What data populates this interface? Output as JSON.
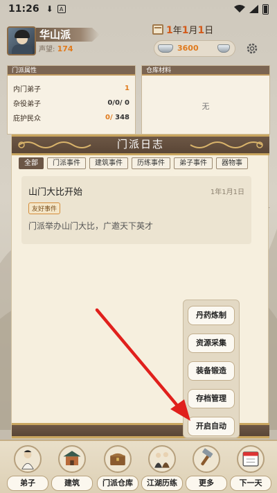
{
  "status_bar": {
    "time": "11:26"
  },
  "header": {
    "sect_name": "华山派",
    "prestige_label": "声望:",
    "prestige_value": "174",
    "date_year": "1",
    "date_year_unit": "年",
    "date_month": "1",
    "date_month_unit": "月",
    "date_day": "1",
    "date_day_unit": "日",
    "silver": "3600"
  },
  "sect_panel": {
    "title": "门派属性",
    "rows": [
      {
        "label": "内门弟子",
        "value": "1"
      },
      {
        "label": "杂役弟子",
        "value": "0/0/ 0"
      },
      {
        "label": "庇护民众",
        "value_current": "0/",
        "value_max": " 348"
      }
    ]
  },
  "storage_panel": {
    "title": "仓库材料",
    "empty": "无"
  },
  "log": {
    "title": "门派日志",
    "tabs": [
      "全部",
      "门派事件",
      "建筑事件",
      "历练事件",
      "弟子事件",
      "器物事"
    ],
    "entry": {
      "title": "山门大比开始",
      "date": "1年1月1日",
      "badge": "友好事件",
      "desc": "门派举办山门大比，广邀天下英才"
    }
  },
  "more_menu": [
    "丹药炼制",
    "资源采集",
    "装备锻造",
    "存档管理",
    "开启自动"
  ],
  "bottom_nav": [
    "弟子",
    "建筑",
    "门派仓库",
    "江湖历练",
    "更多",
    "下一天"
  ],
  "colors": {
    "accent_orange": "#e07a1c",
    "arrow_red": "#e0201c",
    "frame_brown": "#6d5745"
  }
}
